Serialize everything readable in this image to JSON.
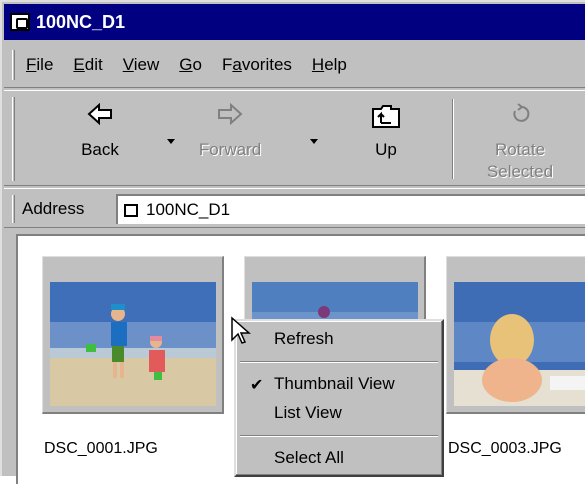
{
  "window": {
    "title": "100NC_D1"
  },
  "menu": {
    "items": [
      "File",
      "Edit",
      "View",
      "Go",
      "Favorites",
      "Help"
    ]
  },
  "toolbar": {
    "back_label": "Back",
    "forward_label": "Forward",
    "up_label": "Up",
    "rotate_label_line1": "Rotate",
    "rotate_label_line2": "Selected"
  },
  "address": {
    "label": "Address",
    "value": "100NC_D1"
  },
  "thumbnails": [
    {
      "filename": "DSC_0001.JPG",
      "icon": "kids-on-beach-photo"
    },
    {
      "filename": "",
      "icon": "water-photo"
    },
    {
      "filename": "DSC_0003.JPG",
      "icon": "child-on-beach-photo"
    }
  ],
  "context_menu": {
    "refresh": "Refresh",
    "thumbnail_view": "Thumbnail View",
    "list_view": "List View",
    "select_all": "Select All",
    "checked_item": "Thumbnail View"
  },
  "colors": {
    "title_bg": "#000080",
    "face": "#c0c0c0"
  }
}
